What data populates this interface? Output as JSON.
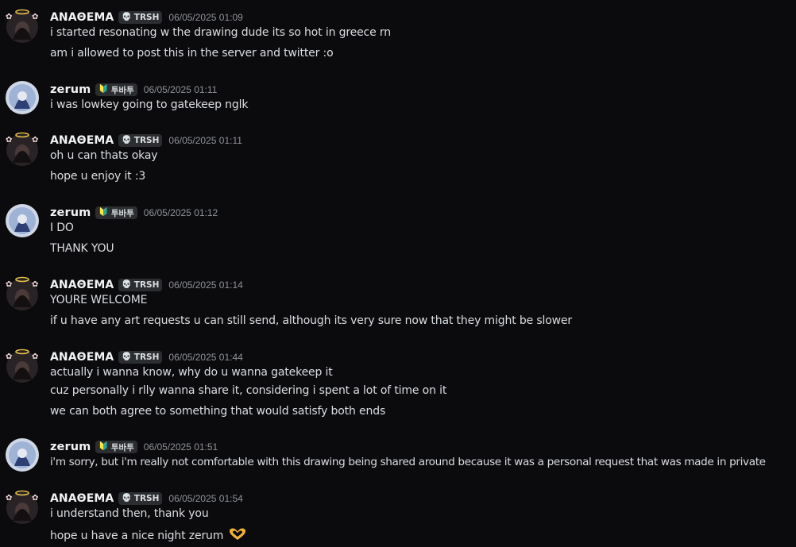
{
  "users": {
    "anathema": {
      "name": "ΑΝΑΘΕΜΑ",
      "tag": "TRSH",
      "tag_icon": "skull-icon"
    },
    "zerum": {
      "name": "zerum",
      "tag": "투바투",
      "tag_icon": "badge-icon"
    }
  },
  "messages": [
    {
      "user": "ΑΝΑΘΕΜΑ",
      "tag": "TRSH",
      "time": "06/05/2025 01:09",
      "lines": [
        "i started resonating w the drawing dude its so hot in greece rn",
        "am i allowed to post this in the server and twitter :o"
      ]
    },
    {
      "user": "zerum",
      "tag": "투바투",
      "time": "06/05/2025 01:11",
      "lines": [
        "i was lowkey going to gatekeep nglk"
      ]
    },
    {
      "user": "ΑΝΑΘΕΜΑ",
      "tag": "TRSH",
      "time": "06/05/2025 01:11",
      "lines": [
        "oh u can thats okay",
        "hope u enjoy it :3"
      ]
    },
    {
      "user": "zerum",
      "tag": "투바투",
      "time": "06/05/2025 01:12",
      "lines": [
        "I DO",
        "THANK YOU"
      ]
    },
    {
      "user": "ΑΝΑΘΕΜΑ",
      "tag": "TRSH",
      "time": "06/05/2025 01:14",
      "lines": [
        "YOURE WELCOME",
        "if u have any art requests u can still send, although its very sure now that they might be slower"
      ]
    },
    {
      "user": "ΑΝΑΘΕΜΑ",
      "tag": "TRSH",
      "time": "06/05/2025 01:44",
      "lines": [
        "actually i wanna know, why do u wanna gatekeep it",
        "cuz personally i rlly wanna share it, considering i spent a lot of time on it",
        "we can both agree to something that would satisfy both ends"
      ]
    },
    {
      "user": "zerum",
      "tag": "투바투",
      "time": "06/05/2025 01:51",
      "lines": [
        "i'm sorry, but i'm really not comfortable with this drawing being shared around because it was a personal request that was made in private"
      ]
    },
    {
      "user": "ΑΝΑΘΕΜΑ",
      "tag": "TRSH",
      "time": "06/05/2025 01:54",
      "lines": [
        "i understand then, thank you",
        "hope u have a nice night zerum"
      ]
    }
  ],
  "colors": {
    "background": "#0b0b0e",
    "text": "#dbdee1",
    "timestamp": "#8e9297",
    "heart": "#f0b232"
  }
}
